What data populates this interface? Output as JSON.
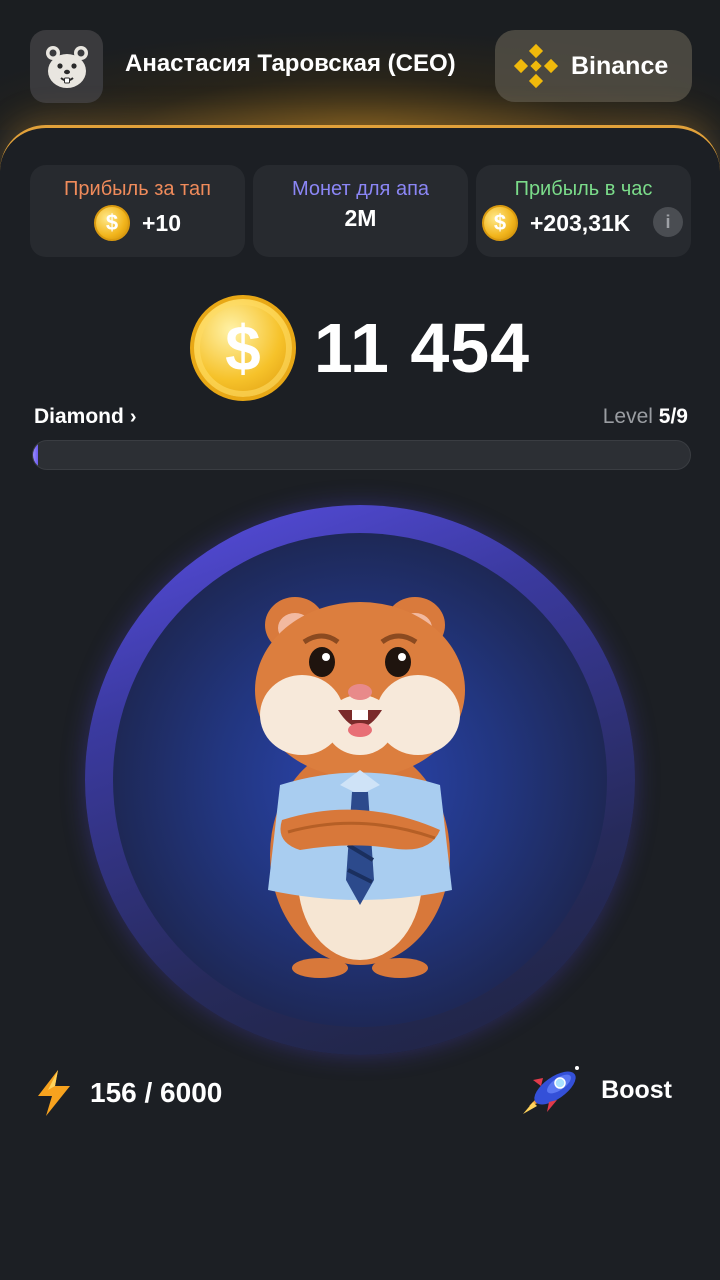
{
  "header": {
    "user_name": "Анастасия Таровская (CEO)",
    "exchange_label": "Binance",
    "avatar_icon": "hamster-avatar-icon",
    "exchange_icon": "binance-logo-icon"
  },
  "stats": [
    {
      "title": "Прибыль за тап",
      "value": "+10",
      "title_color": "#f08b5b",
      "show_coin": true
    },
    {
      "title": "Монет для апа",
      "value": "2M",
      "title_color": "#8b86f5",
      "show_coin": false
    },
    {
      "title": "Прибыль в час",
      "value": "+203,31K",
      "title_color": "#7bdc8a",
      "show_coin": true,
      "info_icon": "i"
    }
  ],
  "balance": {
    "value": "11 454",
    "coin_symbol": "$"
  },
  "league": {
    "name": "Diamond",
    "level_label": "Level",
    "level_value": "5/9",
    "progress": 0.007
  },
  "energy": {
    "value": "156 / 6000",
    "icon": "lightning-icon"
  },
  "boost": {
    "label": "Boost",
    "icon": "rocket-icon"
  },
  "colors": {
    "accent_gold": "#e1a13a",
    "panel": "#1c1f24",
    "card": "#272a2f",
    "tap_ring": "#5a4fe6"
  }
}
